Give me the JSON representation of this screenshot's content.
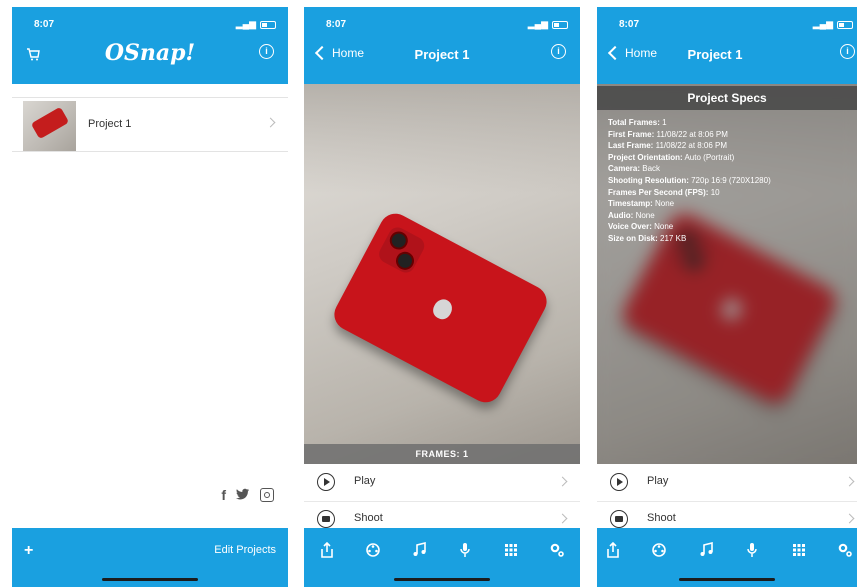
{
  "status": {
    "time": "8:07"
  },
  "screen1": {
    "app_title": "OSnap!",
    "projects": [
      {
        "name": "Project 1"
      }
    ],
    "bottom": {
      "add_label": "+",
      "edit_label": "Edit Projects"
    },
    "social": [
      "facebook-icon",
      "twitter-icon",
      "instagram-icon"
    ]
  },
  "screen2": {
    "back_label": "Home",
    "title": "Project 1",
    "frames_label": "FRAMES: 1",
    "actions": [
      {
        "label": "Play"
      },
      {
        "label": "Shoot"
      }
    ]
  },
  "screen3": {
    "back_label": "Home",
    "title": "Project 1",
    "specs_title": "Project Specs",
    "specs": [
      {
        "key": "Total Frames:",
        "value": "1"
      },
      {
        "key": "First Frame:",
        "value": "11/08/22 at 8:06 PM"
      },
      {
        "key": "Last Frame:",
        "value": "11/08/22 at 8:06 PM"
      },
      {
        "key": "Project Orientation:",
        "value": "Auto (Portrait)"
      },
      {
        "key": "Camera:",
        "value": "Back"
      },
      {
        "key": "Shooting Resolution:",
        "value": "720p 16:9 (720X1280)"
      },
      {
        "key": "Frames Per Second (FPS):",
        "value": "10"
      },
      {
        "key": "Timestamp:",
        "value": "None"
      },
      {
        "key": "Audio:",
        "value": "None"
      },
      {
        "key": "Voice Over:",
        "value": "None"
      },
      {
        "key": "Size on Disk:",
        "value": "217 KB"
      }
    ],
    "actions": [
      {
        "label": "Play"
      },
      {
        "label": "Shoot"
      }
    ]
  },
  "toolbar_icons": [
    "share-icon",
    "film-reel-icon",
    "music-icon",
    "microphone-icon",
    "grid-icon",
    "settings-icon"
  ],
  "colors": {
    "accent": "#1aa0e0",
    "phone_red": "#c8141b"
  }
}
